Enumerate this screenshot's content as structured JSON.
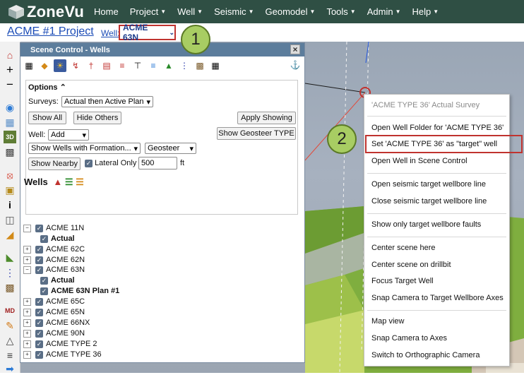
{
  "app": {
    "name": "ZoneVu"
  },
  "nav": {
    "items": [
      {
        "label": "Home",
        "has_caret": false
      },
      {
        "label": "Project",
        "has_caret": true
      },
      {
        "label": "Well",
        "has_caret": true
      },
      {
        "label": "Seismic",
        "has_caret": true
      },
      {
        "label": "Geomodel",
        "has_caret": true
      },
      {
        "label": "Tools",
        "has_caret": true
      },
      {
        "label": "Admin",
        "has_caret": true
      },
      {
        "label": "Help",
        "has_caret": true
      }
    ]
  },
  "header": {
    "project": "ACME #1 Project",
    "well_label": "Well:",
    "well_selected": "ACME 63N"
  },
  "callouts": {
    "one": "1",
    "two": "2"
  },
  "panel": {
    "title": "Scene Control - Wells",
    "options_label": "Options",
    "surveys_label": "Surveys:",
    "surveys_value": "Actual then Active Plan",
    "show_all": "Show All",
    "hide_others": "Hide Others",
    "apply_showing": "Apply Showing",
    "well_label": "Well:",
    "well_mode": "Add",
    "show_geosteer": "Show Geosteer TYPE",
    "formation_filter": "Show Wells with Formation...",
    "geosteer_filter": "Geosteer",
    "show_nearby": "Show Nearby",
    "lateral_only": "Lateral Only",
    "nearby_distance": "500",
    "distance_unit": "ft",
    "wells_heading": "Wells"
  },
  "wells_tree": [
    {
      "label": "ACME 11N",
      "level": 0,
      "expanded": true,
      "bold": false
    },
    {
      "label": "Actual",
      "level": 1,
      "expanded": false,
      "bold": true
    },
    {
      "label": "ACME 62C",
      "level": 0,
      "expanded": false,
      "bold": false
    },
    {
      "label": "ACME 62N",
      "level": 0,
      "expanded": false,
      "bold": false
    },
    {
      "label": "ACME 63N",
      "level": 0,
      "expanded": true,
      "bold": false
    },
    {
      "label": "Actual",
      "level": 1,
      "expanded": false,
      "bold": true
    },
    {
      "label": "ACME 63N Plan #1",
      "level": 1,
      "expanded": false,
      "bold": true
    },
    {
      "label": "ACME 65C",
      "level": 0,
      "expanded": false,
      "bold": false
    },
    {
      "label": "ACME 65N",
      "level": 0,
      "expanded": false,
      "bold": false
    },
    {
      "label": "ACME 66NX",
      "level": 0,
      "expanded": false,
      "bold": false
    },
    {
      "label": "ACME 90N",
      "level": 0,
      "expanded": false,
      "bold": false
    },
    {
      "label": "ACME TYPE 2",
      "level": 0,
      "expanded": false,
      "bold": false
    },
    {
      "label": "ACME TYPE 36",
      "level": 0,
      "expanded": false,
      "bold": false
    }
  ],
  "context_menu": {
    "items": [
      {
        "label": "'ACME TYPE 36' Actual Survey",
        "disabled": true
      },
      {
        "label": "Open Well Folder for 'ACME TYPE 36'"
      },
      {
        "label": "Set 'ACME TYPE 36' as \"target\" well"
      },
      {
        "label": "Open Well in Scene Control"
      },
      {
        "label": "Open seismic target wellbore line"
      },
      {
        "label": "Close seismic target wellbore line"
      },
      {
        "label": "Show only target wellbore faults"
      },
      {
        "label": "Center scene here"
      },
      {
        "label": "Center scene on drillbit"
      },
      {
        "label": "Focus Target Well"
      },
      {
        "label": "Snap Camera to Target Wellbore Axes"
      },
      {
        "label": "Map view"
      },
      {
        "label": "Snap Camera to Axes"
      },
      {
        "label": "Switch to Orthographic Camera"
      }
    ]
  },
  "colors": {
    "nav_bg": "#2f4f44",
    "highlight_border": "#c0332f",
    "callout_fill": "#a8cd63",
    "panel_title_bg": "#5c7d9c",
    "link": "#1a4bb6"
  }
}
